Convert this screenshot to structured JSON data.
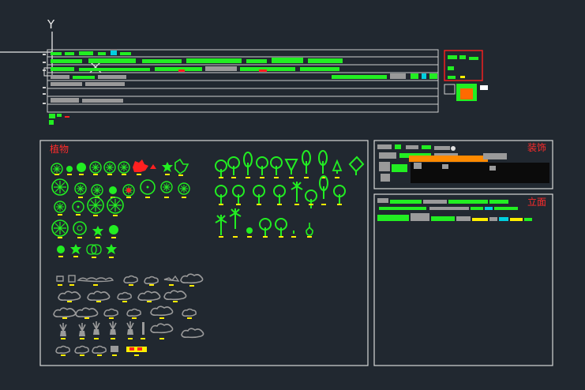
{
  "viewport": {
    "background_color": "#212830",
    "axis_label": "Y",
    "crosshair_color": "#e8e8e8"
  },
  "panels": {
    "plants": {
      "label": "植物",
      "label_color": "#ff2b2b",
      "border_color": "#d8d8d8"
    },
    "decoration": {
      "label": "装饰",
      "label_color": "#ff2b2b",
      "border_color": "#d8d8d8"
    },
    "elevation": {
      "label": "立面",
      "label_color": "#ff2b2b",
      "border_color": "#d8d8d8"
    }
  },
  "colors": {
    "plant_symbol": "#22ee22",
    "shrub_outline": "#9a9a9a",
    "label_mark": "#ffee00",
    "highlight_symbol": "#ff2020",
    "accent_cyan": "#00d0e0",
    "accent_orange": "#ff8a00"
  },
  "icons": {
    "crosshair": "crosshair-icon",
    "ucs": "ucs-icon",
    "tree_plan": "tree-plan-icon",
    "tree_elevation": "tree-elevation-icon",
    "shrub_outline": "shrub-outline-icon"
  }
}
